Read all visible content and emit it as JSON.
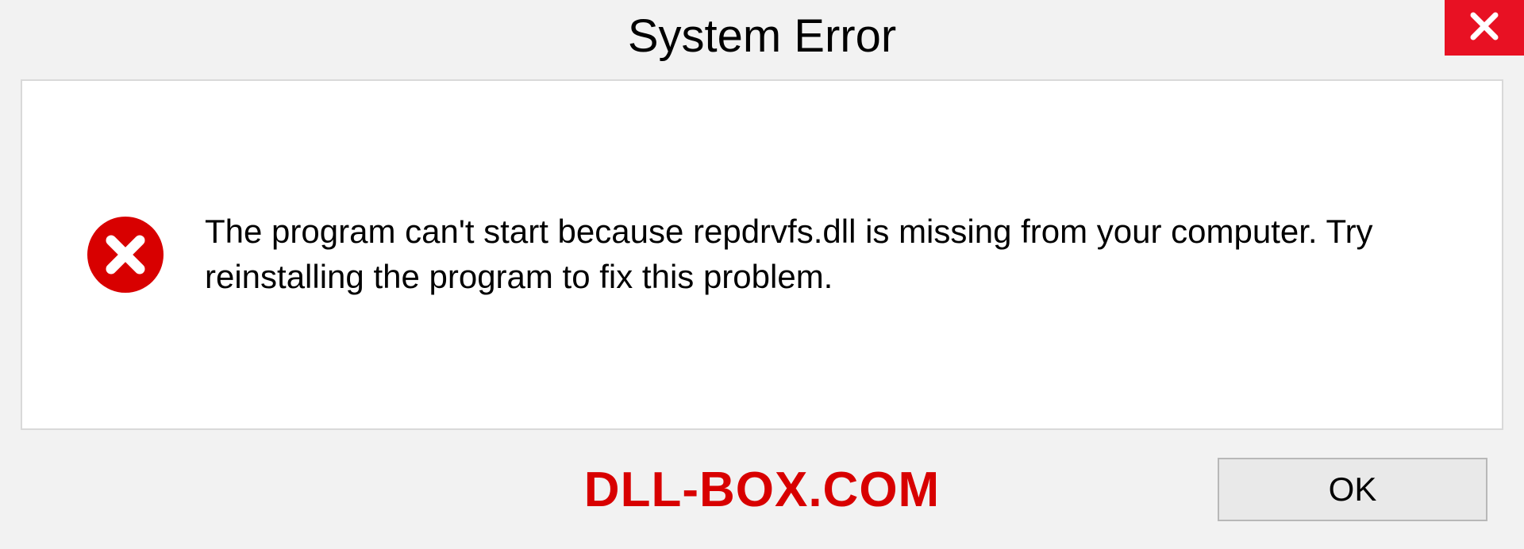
{
  "dialog": {
    "title": "System Error",
    "message": "The program can't start because repdrvfs.dll is missing from your computer. Try reinstalling the program to fix this problem.",
    "ok_label": "OK"
  },
  "watermark": "DLL-BOX.COM"
}
